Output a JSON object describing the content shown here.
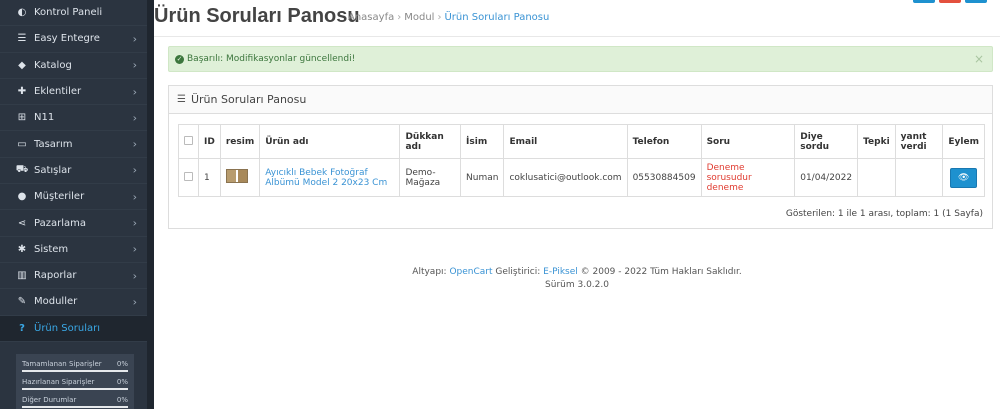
{
  "sidebar": {
    "items": [
      {
        "label": "Kontrol Paneli",
        "icon": "dashboard-icon",
        "glyph": "◐",
        "chevron": false,
        "active": false
      },
      {
        "label": "Easy Entegre",
        "icon": "list-icon",
        "glyph": "☰",
        "chevron": true,
        "active": false
      },
      {
        "label": "Katalog",
        "icon": "tags-icon",
        "glyph": "◆",
        "chevron": true,
        "active": false
      },
      {
        "label": "Eklentiler",
        "icon": "puzzle-icon",
        "glyph": "✚",
        "chevron": true,
        "active": false
      },
      {
        "label": "N11",
        "icon": "sitemap-icon",
        "glyph": "⊞",
        "chevron": true,
        "active": false
      },
      {
        "label": "Tasarım",
        "icon": "monitor-icon",
        "glyph": "▭",
        "chevron": true,
        "active": false
      },
      {
        "label": "Satışlar",
        "icon": "cart-icon",
        "glyph": "⛟",
        "chevron": true,
        "active": false
      },
      {
        "label": "Müşteriler",
        "icon": "user-icon",
        "glyph": "●",
        "chevron": true,
        "active": false
      },
      {
        "label": "Pazarlama",
        "icon": "share-icon",
        "glyph": "⋖",
        "chevron": true,
        "active": false
      },
      {
        "label": "Sistem",
        "icon": "cog-icon",
        "glyph": "✱",
        "chevron": true,
        "active": false
      },
      {
        "label": "Raporlar",
        "icon": "bar-chart-icon",
        "glyph": "▥",
        "chevron": true,
        "active": false
      },
      {
        "label": "Moduller",
        "icon": "plug-icon",
        "glyph": "✎",
        "chevron": true,
        "active": false
      },
      {
        "label": "Ürün Soruları",
        "icon": "question-icon",
        "glyph": "?",
        "chevron": false,
        "active": true
      }
    ],
    "chevron_glyph": "›",
    "stats": [
      {
        "label": "Tamamlanan Siparişler",
        "value": "0%"
      },
      {
        "label": "Hazırlanan Siparişler",
        "value": "0%"
      },
      {
        "label": "Diğer Durumlar",
        "value": "0%"
      }
    ]
  },
  "header": {
    "title": "Ürün Soruları Panosu",
    "breadcrumb": [
      "Anasayfa",
      "Modul",
      "Ürün Soruları Panosu"
    ],
    "breadcrumb_sep": "›"
  },
  "alert": {
    "icon_glyph": "✓",
    "text": "Başarılı: Modifikasyonlar güncellendi!",
    "close": "×"
  },
  "panel": {
    "icon_glyph": "☰",
    "title": "Ürün Soruları Panosu",
    "columns": [
      "ID",
      "resim",
      "Ürün adı",
      "Dükkan adı",
      "İsim",
      "Email",
      "Telefon",
      "Soru",
      "Diye sordu",
      "Tepki",
      "yanıt verdi",
      "Eylem"
    ],
    "rows": [
      {
        "id": "1",
        "product": "Ayıcıklı Bebek Fotoğraf Albümü Model 2 20x23 Cm",
        "shop": "Demo-Mağaza",
        "name": "Numan",
        "email": "coklusatici@outlook.com",
        "phone": "05530884509",
        "question": "Deneme sorusudur deneme",
        "date": "01/04/2022",
        "reaction": "",
        "answered": "",
        "action_glyph": "👁"
      }
    ],
    "pagination": "Gösterilen: 1 ile 1 arası, toplam: 1 (1 Sayfa)"
  },
  "footer": {
    "prefix": "Altyapı: ",
    "opencart": "OpenCart",
    "dev_label": " Geliştirici: ",
    "dev": "E-Piksel",
    "rights": " © 2009 - 2022 Tüm Hakları Saklıdır.",
    "version": "Sürüm 3.0.2.0"
  },
  "colors": {
    "sidebar_bg": "#2b3440",
    "accent": "#1e91cf",
    "success_bg": "#dff0d8",
    "success_text": "#3c763d",
    "question_text": "#e03c31"
  },
  "top_buttons": [
    {
      "name": "top-btn-blue",
      "color": "#1e91cf"
    },
    {
      "name": "top-btn-red",
      "color": "#e3503e"
    },
    {
      "name": "top-btn-blue-2",
      "color": "#1e91cf"
    }
  ]
}
